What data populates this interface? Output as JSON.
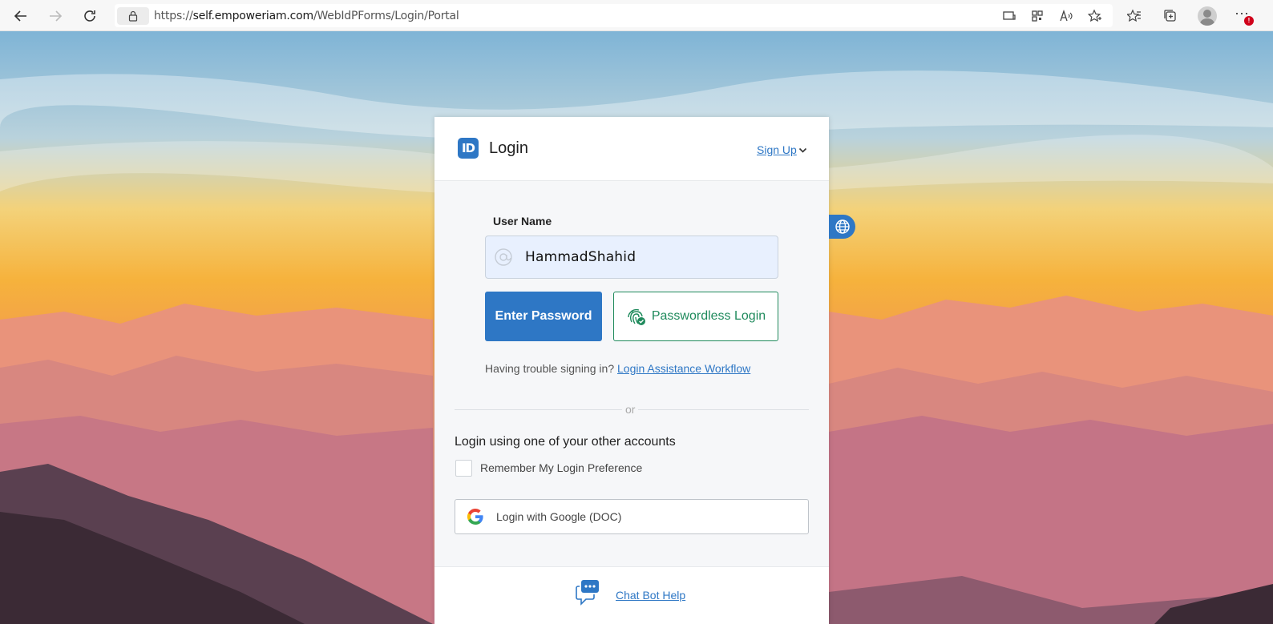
{
  "browser": {
    "url_prefix": "https://",
    "url_host": "self.empoweriam.com",
    "url_path": "/WebIdPForms/Login/Portal"
  },
  "login": {
    "logo_text": "ID",
    "title": "Login",
    "signup_label": "Sign Up",
    "username_label": "User Name",
    "username_value": "HammadShahid",
    "enter_password_label": "Enter Password",
    "passwordless_label": "Passwordless Login",
    "trouble_text": "Having trouble signing in?",
    "assistance_link": "Login Assistance Workflow",
    "or_text": "or",
    "other_accounts_text": "Login using one of your other accounts",
    "remember_label": "Remember My Login Preference",
    "google_label": "Login with Google (DOC)",
    "chatbot_label": "Chat Bot Help"
  },
  "colors": {
    "primary": "#2e77c5",
    "passwordless_green": "#1f8a5c"
  }
}
